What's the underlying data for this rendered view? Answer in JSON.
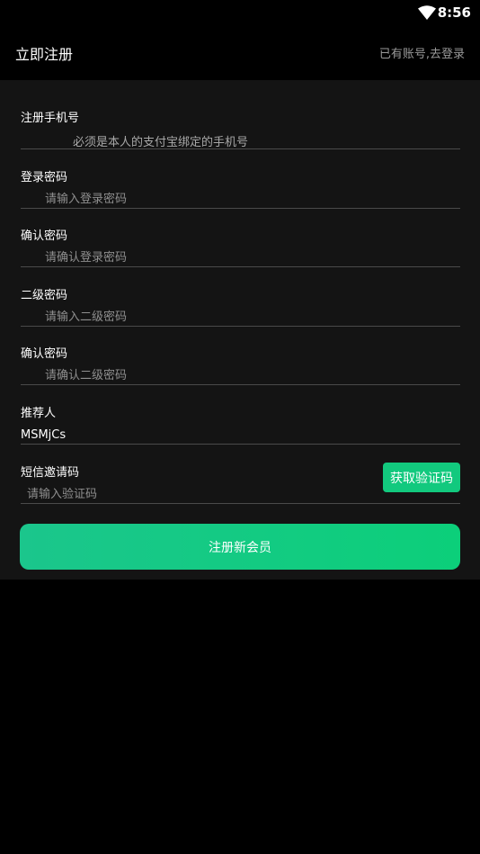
{
  "status_bar": {
    "time": "8:56",
    "icons": [
      "wifi-icon"
    ]
  },
  "header": {
    "title": "立即注册",
    "login_link": "已有账号,去登录"
  },
  "form": {
    "phone": {
      "label": "注册手机号",
      "note": "必须是本人的支付宝绑定的手机号"
    },
    "login_password": {
      "label": "登录密码",
      "placeholder": "请输入登录密码"
    },
    "confirm_login_password": {
      "label": "确认密码",
      "placeholder": "请确认登录密码"
    },
    "second_password": {
      "label": "二级密码",
      "placeholder": "请输入二级密码"
    },
    "confirm_second_password": {
      "label": "确认密码",
      "placeholder": "请确认二级密码"
    },
    "referrer": {
      "label": "推荐人",
      "value": "MSMjCs"
    },
    "sms_code": {
      "label": "短信邀请码",
      "placeholder": "请输入验证码",
      "button": "获取验证码"
    }
  },
  "submit_button": "注册新会员",
  "colors": {
    "accent": "#12c97e",
    "panel_bg": "#141414",
    "divider": "#4a4a4a",
    "placeholder": "#8f8f8f"
  }
}
